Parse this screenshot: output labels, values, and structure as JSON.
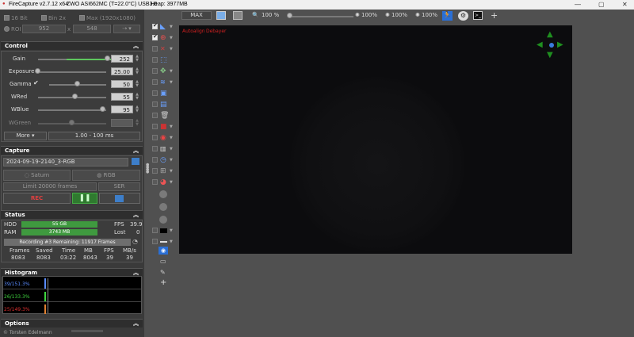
{
  "window": {
    "app_title": "FireCapture v2.7.12 x64",
    "camera": "ZWO ASI662MC (T=22.0°C) USB3.0",
    "heap": "Heap: 3977MB"
  },
  "format": {
    "bit16": "16 Bit",
    "bin2x": "Bin 2x",
    "max_res": "Max (1920x1080)",
    "roi_label": "ROI",
    "roi_w": "952",
    "roi_x": "x",
    "roi_h": "548"
  },
  "control": {
    "title": "Control",
    "gain_label": "Gain",
    "gain_value": "252",
    "gain_fraction": 0.96,
    "exposure_label": "Exposure",
    "exposure_value": "25.00",
    "exposure_fraction": 0.0,
    "gamma_label": "Gamma",
    "gamma_value": "50",
    "gamma_fraction": 0.5,
    "wred_label": "WRed",
    "wred_value": "55",
    "wred_fraction": 0.55,
    "wblue_label": "WBlue",
    "wblue_value": "95",
    "wblue_fraction": 0.95,
    "wgreen_label": "WGreen",
    "wgreen_fraction": 0.5,
    "more_label": "More",
    "range_label": "1.00 - 100 ms"
  },
  "capture": {
    "title": "Capture",
    "filename": "2024-09-19-2140_3-RGB",
    "saturn_label": "Saturn",
    "rgb_label": "RGB",
    "limit_label": "Limit 20000 frames",
    "ser_label": "SER",
    "rec_label": "REC"
  },
  "status": {
    "title": "Status",
    "hdd_label": "HDD",
    "hdd_value": "55 GB",
    "ram_label": "RAM",
    "ram_value": "3743 MB",
    "fps_label": "FPS",
    "fps_value": "39.9",
    "lost_label": "Lost",
    "lost_value": "0",
    "recording_text": "Recording #3   Remaining: 11917 Frames",
    "cols": [
      "Frames",
      "Saved",
      "Time",
      "MB",
      "FPS",
      "MB/s"
    ],
    "vals": [
      "8083",
      "8083",
      "03:22",
      "8043",
      "39",
      "39"
    ]
  },
  "histogram": {
    "title": "Histogram",
    "blue": "39/151.3%",
    "green": "26/133.3%",
    "red": "25/149.3%"
  },
  "options": {
    "title": "Options",
    "footer": "© Torsten Edelmann"
  },
  "toolbar": {
    "max_label": "MAX",
    "zoom": "100 %",
    "zoom_fraction": 0.0,
    "val1": "100%",
    "val2": "100%",
    "val3": "100%"
  },
  "preview": {
    "autoalign": "Autoalign",
    "debayer": "Debayer"
  },
  "colors": {
    "accent_green": "#3f9a3f",
    "rec_red": "#cc3333",
    "overlay_red": "#d02020"
  }
}
